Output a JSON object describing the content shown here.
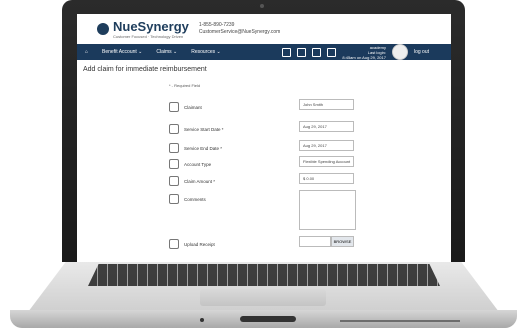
{
  "brand": {
    "name": "NueSynergy",
    "tagline": "Customer Focused · Technology Driven"
  },
  "contact": {
    "phone": "1-855-890-7239",
    "email": "CustomerService@NueSynergy.com"
  },
  "nav": {
    "items": [
      "Benefit Account ⌄",
      "Claims ⌄",
      "Resources ⌄"
    ],
    "logout": "log out",
    "badge": "3"
  },
  "user": {
    "name": "academy",
    "last_login": "Last login:",
    "last_login_value": "8:45am on Aug 29, 2017"
  },
  "page": {
    "title": "Add claim for immediate reimbursement",
    "required_note": "* - Required Field"
  },
  "form": {
    "claimant_label": "Claimant",
    "claimant_value": "John Smith",
    "start_label": "Service Start Date *",
    "start_value": "Aug 29, 2017",
    "end_label": "Service End Date *",
    "end_value": "Aug 29, 2017",
    "account_label": "Account Type",
    "account_value": "Flexible Spending Account",
    "amount_label": "Claim Amount *",
    "amount_value": "0.00",
    "currency": "$",
    "comments_label": "Comments",
    "upload_label": "Upload Receipt",
    "browse": "BROWSE"
  }
}
